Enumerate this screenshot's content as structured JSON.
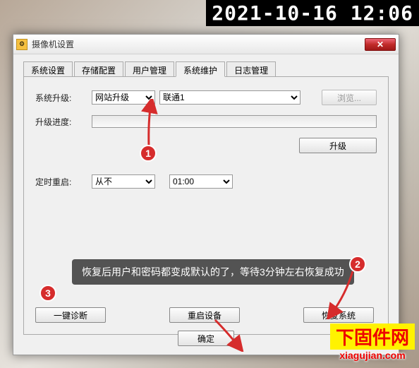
{
  "timestamp": "2021-10-16 12:06",
  "dialog": {
    "title": "摄像机设置",
    "tabs": [
      "系统设置",
      "存储配置",
      "用户管理",
      "系统维护",
      "日志管理"
    ],
    "active_tab": 3,
    "sys_upgrade_label": "系统升级:",
    "upgrade_type": "网站升级",
    "upgrade_line": "联通1",
    "browse_label": "浏览...",
    "progress_label": "升级进度:",
    "upgrade_btn": "升级",
    "restart_label": "定时重启:",
    "restart_mode": "从不",
    "restart_time": "01:00",
    "diagnose_btn": "一键诊断",
    "reboot_btn": "重启设备",
    "restore_btn": "恢复系统",
    "ok_btn": "确定"
  },
  "annotations": {
    "badge1": "1",
    "badge2": "2",
    "badge3": "3",
    "toast": "恢复后用户和密码都变成默认的了，等待3分钟左右恢复成功"
  },
  "watermark": {
    "cn": "下固件网",
    "en": "xiagujian.com"
  }
}
